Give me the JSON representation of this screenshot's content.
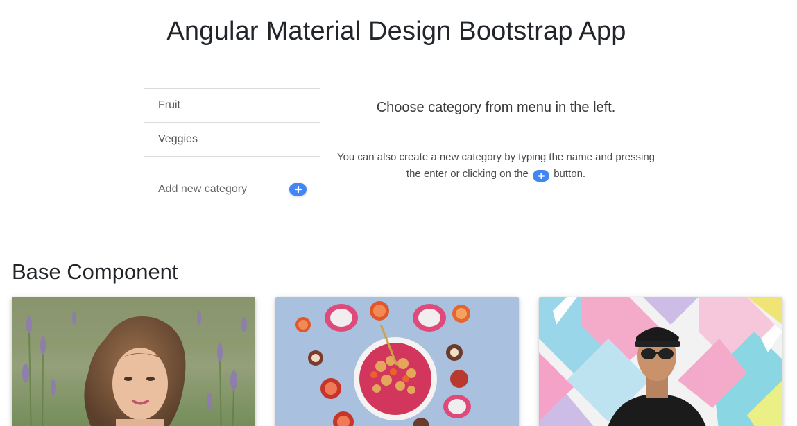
{
  "app": {
    "title": "Angular Material Design Bootstrap App"
  },
  "categories": {
    "items": [
      {
        "label": "Fruit"
      },
      {
        "label": "Veggies"
      }
    ],
    "add_placeholder": "Add new category",
    "add_button_icon": "plus-icon"
  },
  "info": {
    "heading": "Choose category from menu in the left.",
    "text_before": "You can also create a new category by typing the name and pressing the enter or clicking on the",
    "text_after": "button.",
    "inline_icon": "plus-icon"
  },
  "section": {
    "title": "Base Component"
  },
  "cards": [
    {
      "image": "woman-in-lavender-field"
    },
    {
      "image": "smoothie-bowl-with-fruit"
    },
    {
      "image": "man-with-sunglasses-colorful-wall"
    }
  ],
  "colors": {
    "accent": "#4285f4",
    "border": "#dcdcdc"
  }
}
